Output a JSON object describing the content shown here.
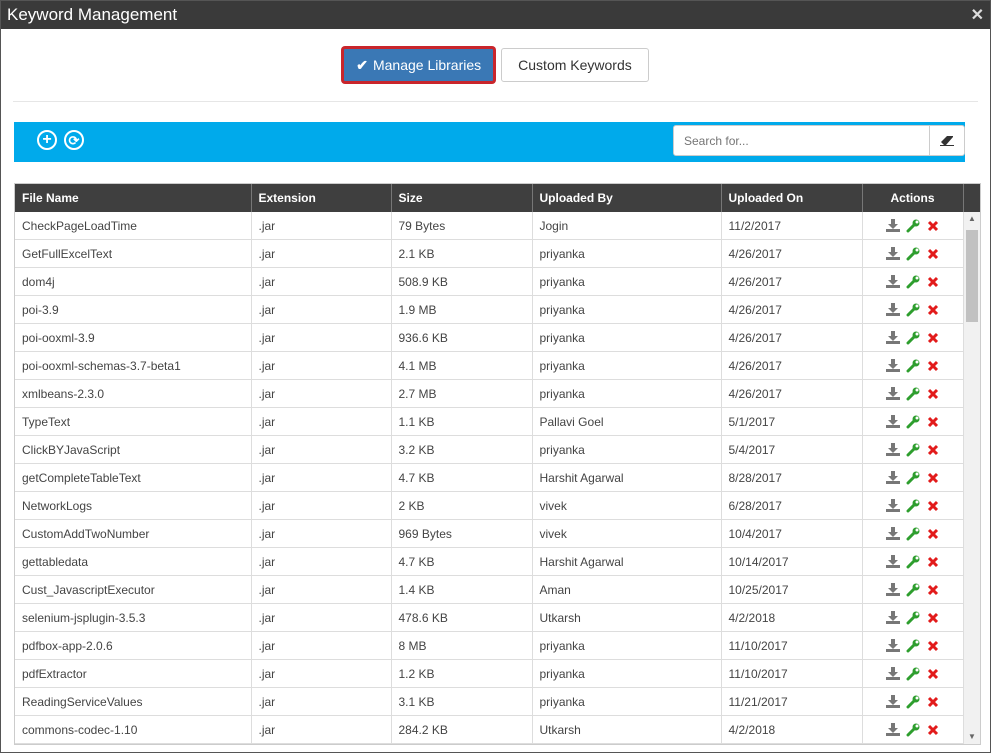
{
  "window": {
    "title": "Keyword Management",
    "close_icon": "close-icon"
  },
  "tabs": [
    {
      "label": "Manage Libraries",
      "active": true
    },
    {
      "label": "Custom Keywords",
      "active": false
    }
  ],
  "toolbar": {
    "add_icon": "plus-circle-icon",
    "refresh_icon": "refresh-icon",
    "search_placeholder": "Search for...",
    "clear_icon": "eraser-icon",
    "color": "#00aaeb"
  },
  "table": {
    "columns": [
      "File Name",
      "Extension",
      "Size",
      "Uploaded By",
      "Uploaded On",
      "Actions"
    ],
    "rows": [
      [
        "CheckPageLoadTime",
        ".jar",
        "79 Bytes",
        "Jogin",
        "11/2/2017"
      ],
      [
        "GetFullExcelText",
        ".jar",
        "2.1 KB",
        "priyanka",
        "4/26/2017"
      ],
      [
        "dom4j",
        ".jar",
        "508.9 KB",
        "priyanka",
        "4/26/2017"
      ],
      [
        "poi-3.9",
        ".jar",
        "1.9 MB",
        "priyanka",
        "4/26/2017"
      ],
      [
        "poi-ooxml-3.9",
        ".jar",
        "936.6 KB",
        "priyanka",
        "4/26/2017"
      ],
      [
        "poi-ooxml-schemas-3.7-beta1",
        ".jar",
        "4.1 MB",
        "priyanka",
        "4/26/2017"
      ],
      [
        "xmlbeans-2.3.0",
        ".jar",
        "2.7 MB",
        "priyanka",
        "4/26/2017"
      ],
      [
        "TypeText",
        ".jar",
        "1.1 KB",
        "Pallavi Goel",
        "5/1/2017"
      ],
      [
        "ClickBYJavaScript",
        ".jar",
        "3.2 KB",
        "priyanka",
        "5/4/2017"
      ],
      [
        "getCompleteTableText",
        ".jar",
        "4.7 KB",
        "Harshit Agarwal",
        "8/28/2017"
      ],
      [
        "NetworkLogs",
        ".jar",
        "2 KB",
        "vivek",
        "6/28/2017"
      ],
      [
        "CustomAddTwoNumber",
        ".jar",
        "969 Bytes",
        "vivek",
        "10/4/2017"
      ],
      [
        "gettabledata",
        ".jar",
        "4.7 KB",
        "Harshit Agarwal",
        "10/14/2017"
      ],
      [
        "Cust_JavascriptExecutor",
        ".jar",
        "1.4 KB",
        "Aman",
        "10/25/2017"
      ],
      [
        "selenium-jsplugin-3.5.3",
        ".jar",
        "478.6 KB",
        "Utkarsh",
        "4/2/2018"
      ],
      [
        "pdfbox-app-2.0.6",
        ".jar",
        "8 MB",
        "priyanka",
        "11/10/2017"
      ],
      [
        "pdfExtractor",
        ".jar",
        "1.2 KB",
        "priyanka",
        "11/10/2017"
      ],
      [
        "ReadingServiceValues",
        ".jar",
        "3.1 KB",
        "priyanka",
        "11/21/2017"
      ],
      [
        "commons-codec-1.10",
        ".jar",
        "284.2 KB",
        "Utkarsh",
        "4/2/2018"
      ]
    ],
    "row_actions": [
      "download-icon",
      "wrench-icon",
      "delete-icon"
    ]
  }
}
